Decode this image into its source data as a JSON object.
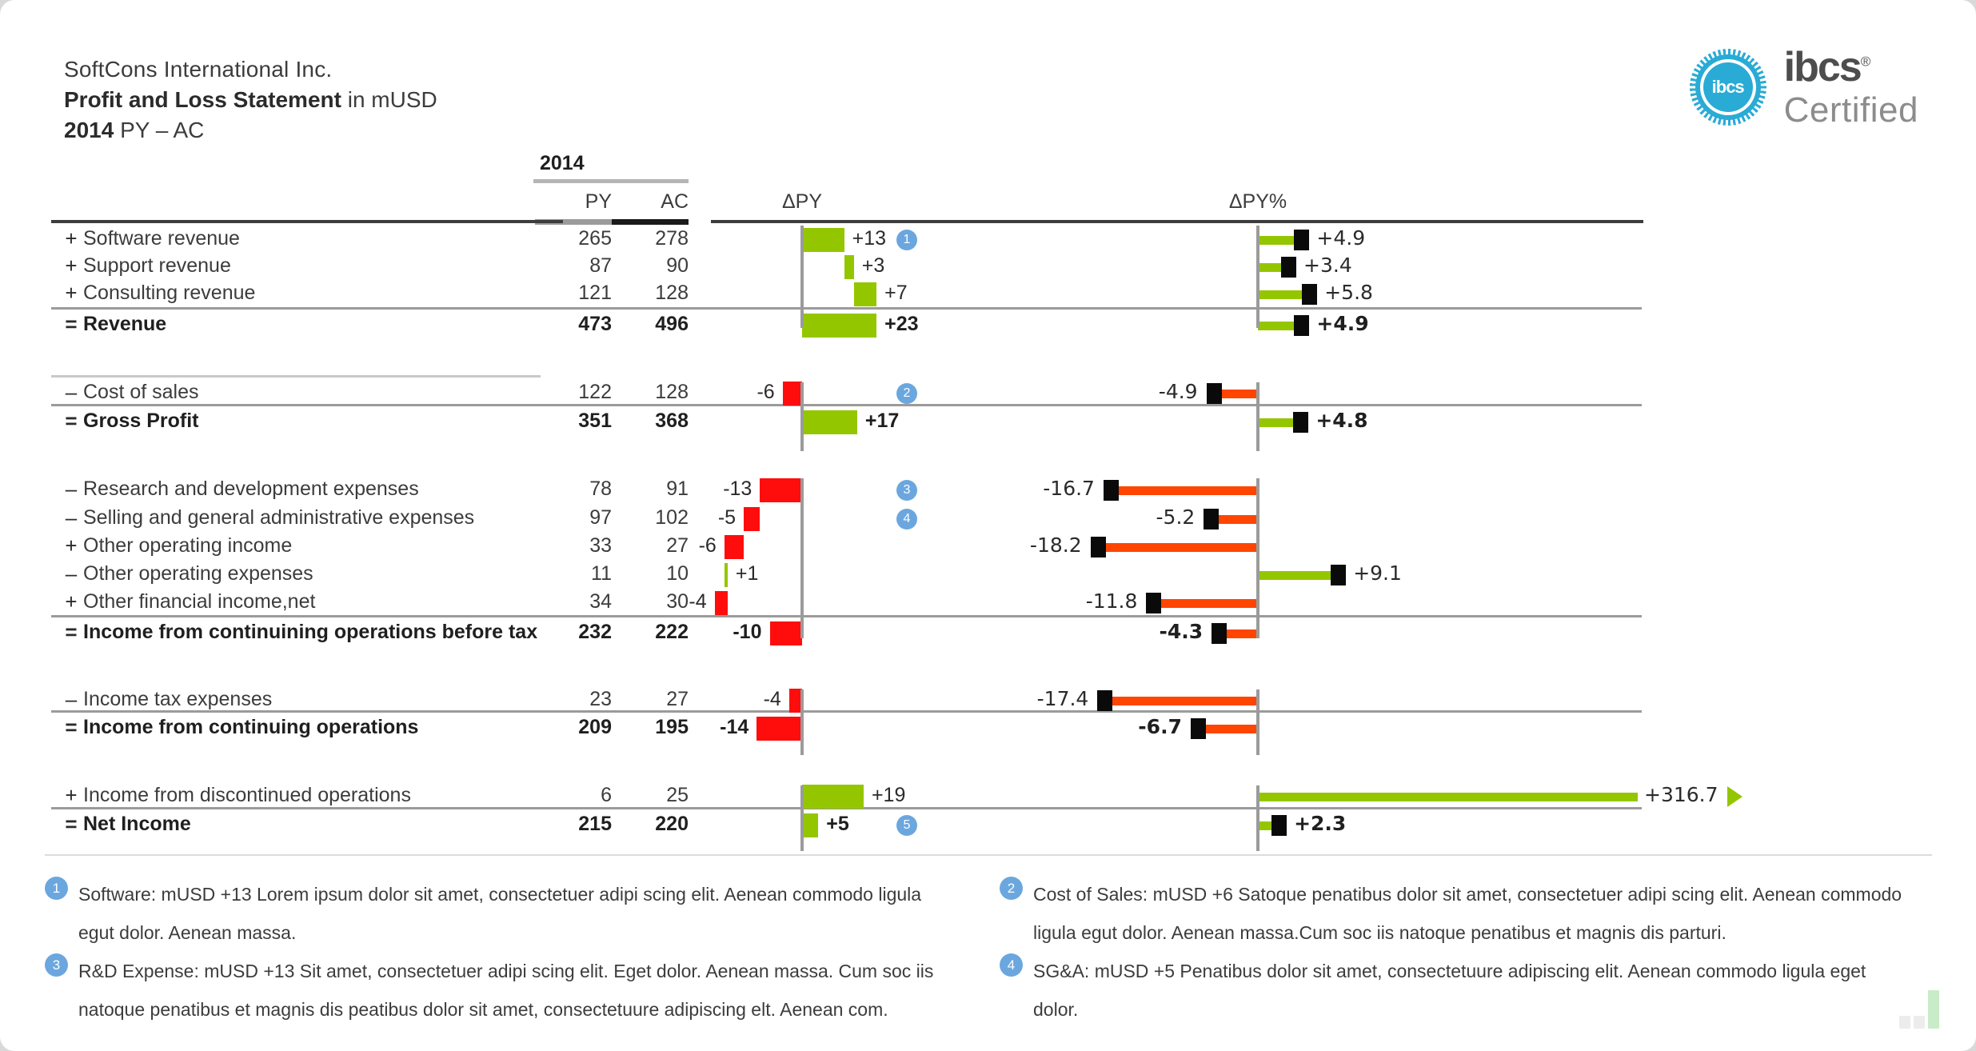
{
  "header": {
    "company": "SoftCons International Inc.",
    "title_bold": "Profit and Loss Statement",
    "title_rest": " in mUSD",
    "year_bold": "2014",
    "year_rest": " PY – AC"
  },
  "logo": {
    "seal_text": "ibcs",
    "wordmark": "ibcs",
    "registered": "®",
    "certified": "Certified"
  },
  "columns": {
    "year": "2014",
    "py": "PY",
    "ac": "AC",
    "dpy": "ΔPY",
    "dpypct": "ΔPY%"
  },
  "chart_data": {
    "type": "bar",
    "title": "Profit and Loss Statement in mUSD",
    "subtitle": "2014 PY – AC",
    "categories": [
      "Software revenue",
      "Support revenue",
      "Consulting revenue",
      "Revenue",
      "Cost of sales",
      "Gross Profit",
      "Research and development expenses",
      "Selling and general administrative expenses",
      "Other operating income",
      "Other operating expenses",
      "Other financial income,net",
      "Income from continuining operations before tax",
      "Income tax expenses",
      "Income from continuing operations",
      "Income from discontinued operations",
      "Net Income"
    ],
    "series": [
      {
        "name": "PY",
        "values": [
          265,
          87,
          121,
          473,
          122,
          351,
          78,
          97,
          33,
          11,
          34,
          232,
          23,
          209,
          6,
          215
        ]
      },
      {
        "name": "AC",
        "values": [
          278,
          90,
          128,
          496,
          128,
          368,
          91,
          102,
          27,
          10,
          30,
          222,
          27,
          195,
          25,
          220
        ]
      },
      {
        "name": "ΔPY",
        "values": [
          13,
          3,
          7,
          23,
          -6,
          17,
          -13,
          -5,
          -6,
          1,
          -4,
          -10,
          -4,
          -14,
          19,
          5
        ]
      },
      {
        "name": "ΔPY%",
        "values": [
          4.9,
          3.4,
          5.8,
          4.9,
          -4.9,
          4.8,
          -16.7,
          -5.2,
          -18.2,
          9.1,
          -11.8,
          -4.3,
          -17.4,
          -6.7,
          316.7,
          2.3
        ]
      }
    ],
    "xlabel": "",
    "ylabel": "",
    "grid": false,
    "legend": "none"
  },
  "rows": [
    {
      "sign": "+",
      "label": "Software revenue",
      "py": "265",
      "ac": "278",
      "dpy": "+13",
      "dpypct": "+4.9",
      "bold": false,
      "note": "1"
    },
    {
      "sign": "+",
      "label": "Support revenue",
      "py": "87",
      "ac": "90",
      "dpy": "+3",
      "dpypct": "+3.4",
      "bold": false,
      "note": ""
    },
    {
      "sign": "+",
      "label": "Consulting revenue",
      "py": "121",
      "ac": "128",
      "dpy": "+7",
      "dpypct": "+5.8",
      "bold": false,
      "note": ""
    },
    {
      "sign": "=",
      "label": "Revenue",
      "py": "473",
      "ac": "496",
      "dpy": "+23",
      "dpypct": "+4.9",
      "bold": true,
      "note": ""
    },
    {
      "sign": "–",
      "label": "Cost of sales",
      "py": "122",
      "ac": "128",
      "dpy": "-6",
      "dpypct": "-4.9",
      "bold": false,
      "note": "2"
    },
    {
      "sign": "=",
      "label": "Gross Profit",
      "py": "351",
      "ac": "368",
      "dpy": "+17",
      "dpypct": "+4.8",
      "bold": true,
      "note": ""
    },
    {
      "sign": "–",
      "label": "Research and development expenses",
      "py": "78",
      "ac": "91",
      "dpy": "-13",
      "dpypct": "-16.7",
      "bold": false,
      "note": "3"
    },
    {
      "sign": "–",
      "label": "Selling and general administrative expenses",
      "py": "97",
      "ac": "102",
      "dpy": "-5",
      "dpypct": "-5.2",
      "bold": false,
      "note": "4"
    },
    {
      "sign": "+",
      "label": "Other operating income",
      "py": "33",
      "ac": "27",
      "dpy": "-6",
      "dpypct": "-18.2",
      "bold": false,
      "note": ""
    },
    {
      "sign": "–",
      "label": "Other operating expenses",
      "py": "11",
      "ac": "10",
      "dpy": "+1",
      "dpypct": "+9.1",
      "bold": false,
      "note": ""
    },
    {
      "sign": "+",
      "label": "Other financial income,net",
      "py": "34",
      "ac": "30",
      "dpy": "-4",
      "dpypct": "-11.8",
      "bold": false,
      "note": ""
    },
    {
      "sign": "=",
      "label": "Income from continuining operations before tax",
      "py": "232",
      "ac": "222",
      "dpy": "-10",
      "dpypct": "-4.3",
      "bold": true,
      "note": ""
    },
    {
      "sign": "–",
      "label": "Income tax expenses",
      "py": "23",
      "ac": "27",
      "dpy": "-4",
      "dpypct": "-17.4",
      "bold": false,
      "note": ""
    },
    {
      "sign": "=",
      "label": "Income from continuing operations",
      "py": "209",
      "ac": "195",
      "dpy": "-14",
      "dpypct": "-6.7",
      "bold": true,
      "note": ""
    },
    {
      "sign": "+",
      "label": "Income from discontinued operations",
      "py": "6",
      "ac": "25",
      "dpy": "+19",
      "dpypct": "+316.7",
      "bold": false,
      "note": ""
    },
    {
      "sign": "=",
      "label": "Net Income",
      "py": "215",
      "ac": "220",
      "dpy": "+5",
      "dpypct": "+2.3",
      "bold": true,
      "note": "5"
    }
  ],
  "footnotes": [
    {
      "n": "1",
      "text": "Software: mUSD +13 Lorem ipsum dolor sit amet, consectetuer adipi scing elit. Aenean commodo ligula egut dolor. Aenean massa."
    },
    {
      "n": "2",
      "text": "Cost of Sales: mUSD +6 Satoque penatibus dolor sit amet, consectetuer adipi scing elit. Aenean commodo ligula egut dolor. Aenean massa.Cum soc iis natoque penatibus et magnis dis parturi."
    },
    {
      "n": "3",
      "text": "R&D Expense: mUSD +13 Sit amet, consectetuer adipi scing elit. Eget dolor. Aenean massa. Cum soc iis natoque penatibus et magnis dis peatibus dolor sit amet, consectetuure adipiscing elt. Aenean com."
    },
    {
      "n": "4",
      "text": "SG&A: mUSD +5 Penatibus dolor sit amet, consectetuure adipiscing elit. Aenean commodo ligula eget dolor."
    }
  ],
  "colors": {
    "positive": "#94C600",
    "negative": "#FF0D0D",
    "pct_negative": "#FF4500",
    "marker": "#6BA7DE",
    "brand": "#29ABD6",
    "ac_bar": "#1a1a1a",
    "py_bar": "#9b9b9b"
  }
}
